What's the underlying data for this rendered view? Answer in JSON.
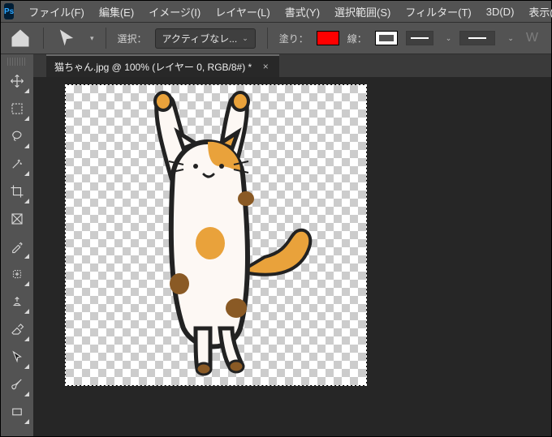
{
  "menu": {
    "items": [
      "ファイル(F)",
      "編集(E)",
      "イメージ(I)",
      "レイヤー(L)",
      "書式(Y)",
      "選択範囲(S)",
      "フィルター(T)",
      "3D(D)",
      "表示(V)"
    ]
  },
  "options": {
    "select_label": "選択：",
    "select_value": "アクティブなレ...",
    "fill_label": "塗り：",
    "fill_color": "#ff0000",
    "stroke_label": "線：",
    "trailing_letter": "W"
  },
  "document": {
    "tab_title": "猫ちゃん.jpg @ 100% (レイヤー 0, RGB/8#) *",
    "tab_close": "×"
  },
  "tools": [
    {
      "name": "move-tool"
    },
    {
      "name": "marquee-tool"
    },
    {
      "name": "lasso-tool"
    },
    {
      "name": "magic-wand-tool"
    },
    {
      "name": "crop-tool"
    },
    {
      "name": "frame-tool"
    },
    {
      "name": "eyedropper-tool"
    },
    {
      "name": "healing-brush-tool"
    },
    {
      "name": "clone-stamp-tool"
    },
    {
      "name": "eraser-tool"
    },
    {
      "name": "path-selection-tool"
    },
    {
      "name": "brush-tool"
    },
    {
      "name": "rectangle-tool"
    }
  ]
}
